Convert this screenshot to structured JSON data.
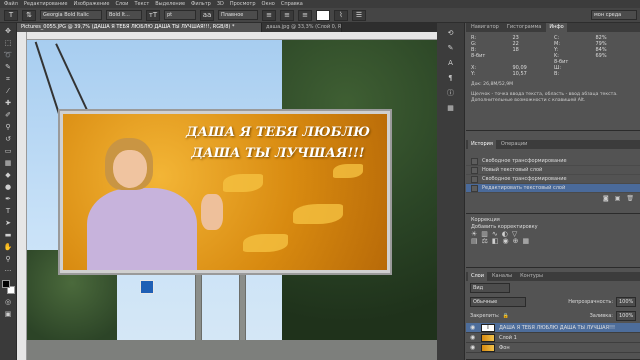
{
  "menubar": {
    "items": [
      "Файл",
      "Редактирование",
      "Изображение",
      "Слои",
      "Текст",
      "Выделение",
      "Фильтр",
      "3D",
      "Просмотр",
      "Окно",
      "Справка"
    ]
  },
  "options": {
    "font_family": "Georgia Bold Italic",
    "font_style": "Bold It...",
    "font_size": "pt",
    "antialias": "Плавное",
    "workspace": "мон среда"
  },
  "tabs": {
    "active": "Pictures_0055.JPG @ 39,7% (ДАША Я ТЕБЯ ЛЮБЛЮ ДАША ТЫ ЛУЧШАЯ!!!, RGB/8) *",
    "inactive": "даша.jpg @ 33,3% (Слой 0, RGB/8) *"
  },
  "billboard": {
    "line1": "ДАША Я ТЕБЯ ЛЮБЛЮ",
    "line2": "ДАША ТЫ ЛУЧШАЯ!!!"
  },
  "panels": {
    "info_tabs": [
      "Навигатор",
      "Гистограмма",
      "Инфо"
    ],
    "info_values": {
      "r": "R:",
      "g": "G:",
      "b": "B:",
      "r_val": "23",
      "g_val": "22",
      "b_val": "18",
      "c": "C:",
      "m": "M:",
      "y": "Y:",
      "k": "K:",
      "c_val": "82%",
      "m_val": "79%",
      "y_val": "84%",
      "k_val": "69%",
      "bits": "8-бит",
      "bits2": "8-бит",
      "x": "X:",
      "y2": "Y:",
      "x_val": "90,09",
      "y_val2": "10,57",
      "w": "Ш:",
      "h": "В:",
      "doc": "Док: 26,8M/52,9M"
    },
    "info_note": "Щелчок - точка ввода текста, область - ввод абзаца текста. Дополнительные возможности с клавишей Alt.",
    "history_tabs": [
      "История",
      "Операции"
    ],
    "history_items": [
      "Свободное трансформирование",
      "Новый текстовый слой",
      "Свободное трансформирование",
      "Редактировать текстовый слой"
    ],
    "corr_title": "Коррекция",
    "corr_add": "Добавить корректировку",
    "layers_tabs": [
      "Слои",
      "Каналы",
      "Контуры"
    ],
    "layers_kind": "Вид",
    "blend_mode": "Обычные",
    "opacity_label": "Непрозрачность:",
    "opacity_val": "100%",
    "lock_label": "Закрепить:",
    "fill_label": "Заливка:",
    "fill_val": "100%",
    "layers": [
      "ДАША Я ТЕБЯ ЛЮБЛЮ ДАША ТЫ ЛУЧШАЯ!!!",
      "Слой 1",
      "Фон"
    ]
  }
}
